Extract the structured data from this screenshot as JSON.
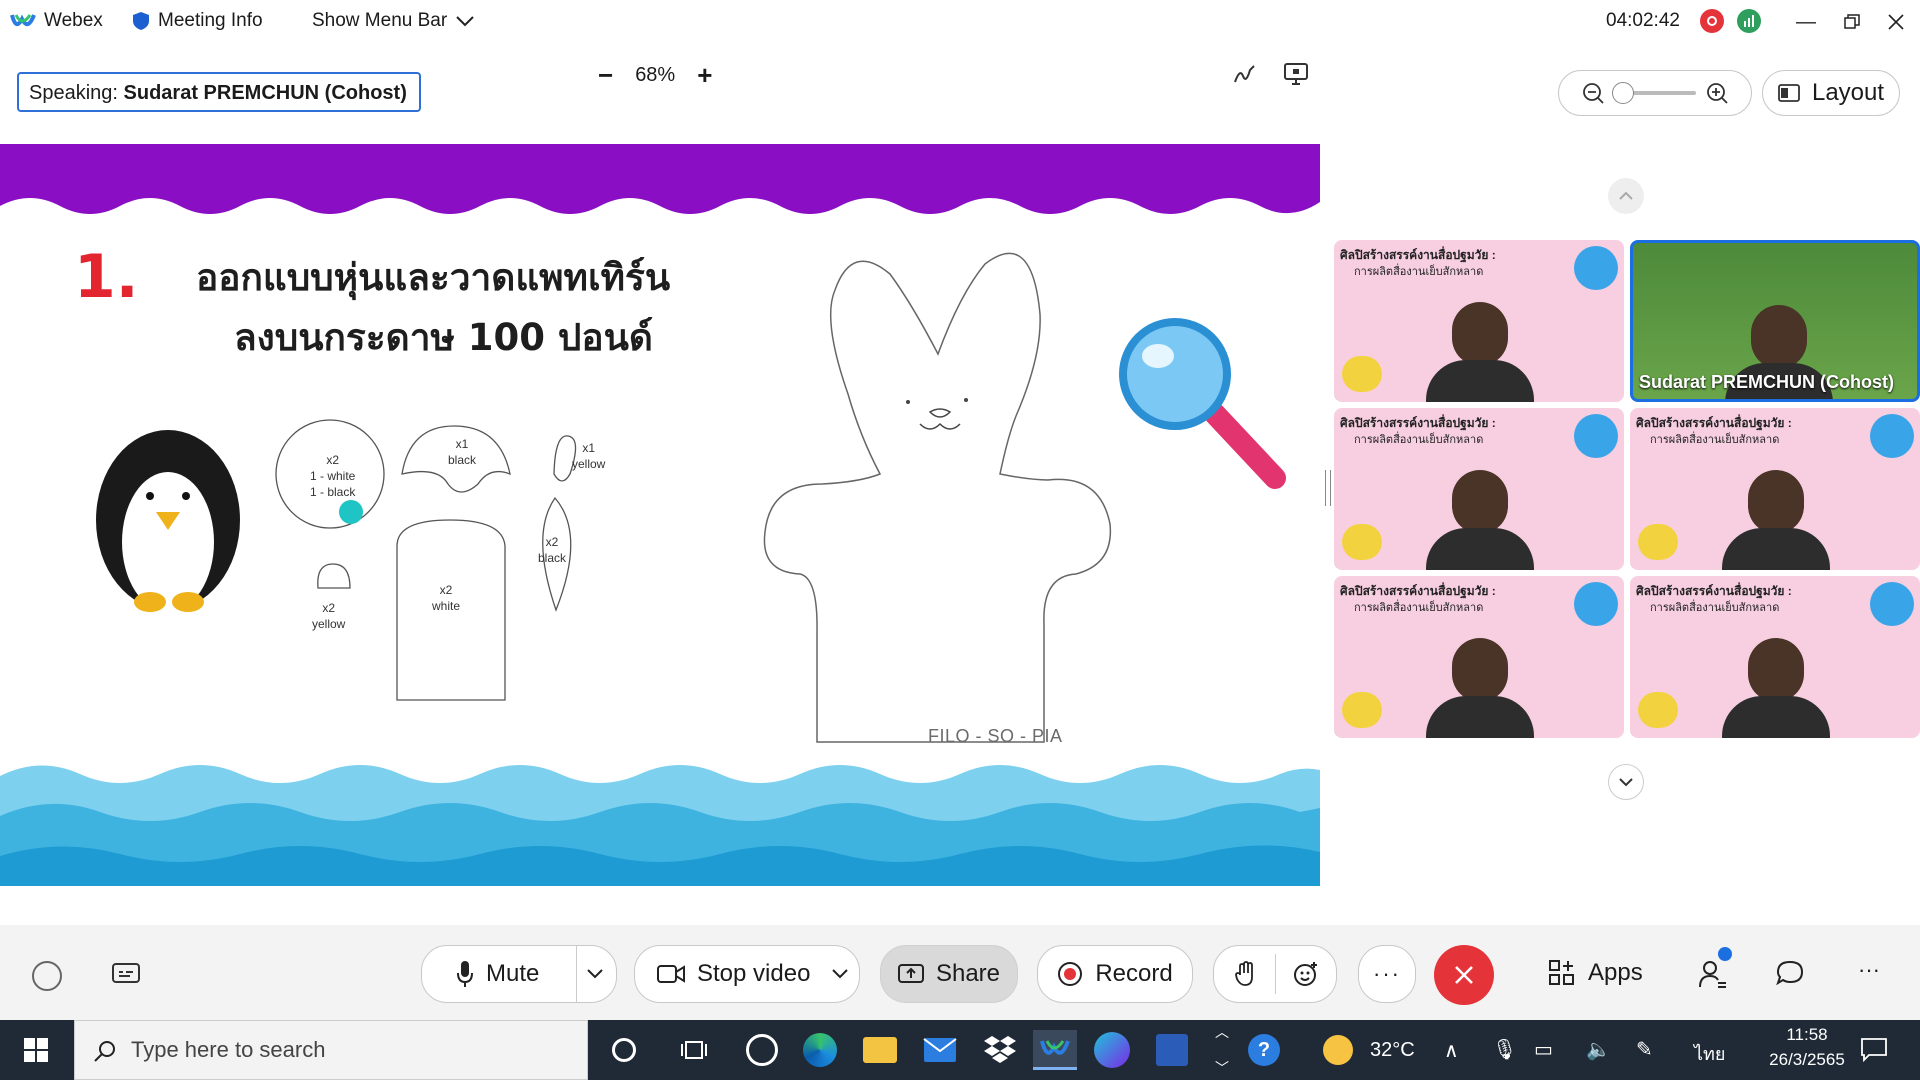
{
  "titlebar": {
    "app_name": "Webex",
    "meeting_info": "Meeting Info",
    "show_menu_bar": "Show Menu Bar",
    "timer": "04:02:42"
  },
  "toolbar": {
    "speaking_label": "Speaking:",
    "speaking_name": "Sudarat PREMCHUN (Cohost)",
    "zoom_minus": "−",
    "zoom_level": "68%",
    "zoom_plus": "+"
  },
  "slide": {
    "step_number": "1.",
    "title_line1": "ออกแบบหุ่นและวาดแพทเทิร์น",
    "title_line2": "ลงบนกระดาษ 100 ปอนด์",
    "parts": [
      {
        "id": "circle",
        "lines": [
          "x2",
          "1 - white",
          "1 - black"
        ]
      },
      {
        "id": "cap",
        "lines": [
          "x1",
          "black"
        ]
      },
      {
        "id": "drop",
        "lines": [
          "x1",
          "yellow"
        ]
      },
      {
        "id": "small-arch",
        "lines": [
          "x2",
          "yellow"
        ]
      },
      {
        "id": "body",
        "lines": [
          "x2",
          "white"
        ]
      },
      {
        "id": "wing",
        "lines": [
          "x2",
          "black"
        ]
      }
    ],
    "watermark": "FILO - SO - PIA"
  },
  "rightpanel": {
    "layout_label": "Layout",
    "tiles": [
      {
        "caption": "ศิลปิสร้างสรรค์งานสื่อปฐมวัย :",
        "sub": "การผลิตสื่องานเย็บสักหลาด",
        "name": ""
      },
      {
        "caption": "",
        "sub": "",
        "name": "Sudarat PREMCHUN (Cohost)"
      },
      {
        "caption": "ศิลปิสร้างสรรค์งานสื่อปฐมวัย :",
        "sub": "การผลิตสื่องานเย็บสักหลาด",
        "name": ""
      },
      {
        "caption": "ศิลปิสร้างสรรค์งานสื่อปฐมวัย :",
        "sub": "การผลิตสื่องานเย็บสักหลาด",
        "name": ""
      },
      {
        "caption": "ศิลปิสร้างสรรค์งานสื่อปฐมวัย :",
        "sub": "การผลิตสื่องานเย็บสักหลาด",
        "name": ""
      },
      {
        "caption": "ศิลปิสร้างสรรค์งานสื่อปฐมวัย :",
        "sub": "การผลิตสื่องานเย็บสักหลาด",
        "name": ""
      }
    ]
  },
  "controls": {
    "mute": "Mute",
    "stop_video": "Stop video",
    "share": "Share",
    "record": "Record",
    "apps": "Apps"
  },
  "taskbar": {
    "search_placeholder": "Type here to search",
    "temperature": "32°C",
    "language": "ไทย",
    "time": "11:58",
    "date": "26/3/2565"
  },
  "colors": {
    "purple_band": "#8a0fc4",
    "wave_blue": "#3fb3e0",
    "end_call_red": "#e5333a",
    "accent_blue": "#2e6fd8"
  }
}
